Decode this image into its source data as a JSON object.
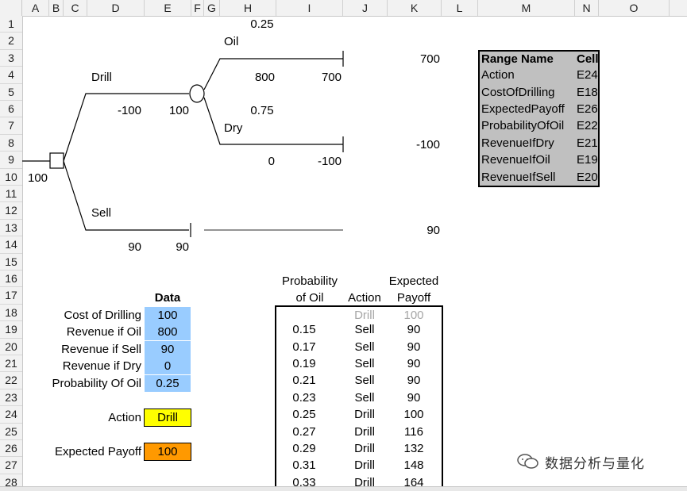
{
  "columns": [
    "A",
    "B",
    "C",
    "D",
    "E",
    "F",
    "G",
    "H",
    "I",
    "J",
    "K",
    "L",
    "M",
    "N",
    "O"
  ],
  "rows": [
    "1",
    "2",
    "3",
    "4",
    "5",
    "6",
    "7",
    "8",
    "9",
    "10",
    "11",
    "12",
    "13",
    "14",
    "15",
    "16",
    "17",
    "18",
    "19",
    "20",
    "21",
    "22",
    "23",
    "24",
    "25",
    "26",
    "27",
    "28"
  ],
  "tree": {
    "prob_oil": "0.25",
    "oil_label": "Oil",
    "oil_revenue": "800",
    "oil_total": "700",
    "oil_end": "700",
    "drill_label": "Drill",
    "drill_cost": "-100",
    "drill_value": "100",
    "prob_dry": "0.75",
    "dry_label": "Dry",
    "dry_end": "-100",
    "dry_revenue": "0",
    "dry_total": "-100",
    "root_value": "100",
    "sell_label": "Sell",
    "sell_revenue": "90",
    "sell_total": "90",
    "sell_end": "90"
  },
  "range_names": {
    "header_name": "Range Name",
    "header_cell": "Cell",
    "rows": [
      {
        "name": "Action",
        "cell": "E24"
      },
      {
        "name": "CostOfDrilling",
        "cell": "E18"
      },
      {
        "name": "ExpectedPayoff",
        "cell": "E26"
      },
      {
        "name": "ProbabilityOfOil",
        "cell": "E22"
      },
      {
        "name": "RevenueIfDry",
        "cell": "E21"
      },
      {
        "name": "RevenueIfOil",
        "cell": "E19"
      },
      {
        "name": "RevenueIfSell",
        "cell": "E20"
      }
    ]
  },
  "inputs": {
    "data_header": "Data",
    "cost_label": "Cost of Drilling",
    "cost_value": "100",
    "rev_oil_label": "Revenue if Oil",
    "rev_oil_value": "800",
    "rev_sell_label": "Revenue if Sell",
    "rev_sell_value": "90",
    "rev_dry_label": "Revenue if Dry",
    "rev_dry_value": "0",
    "prob_label": "Probability Of Oil",
    "prob_value": "0.25",
    "action_label": "Action",
    "action_value": "Drill",
    "payoff_label": "Expected Payoff",
    "payoff_value": "100",
    "colors": {
      "input_blue": "#99ccff",
      "action_yellow": "#ffff00",
      "payoff_orange": "#ff9900"
    }
  },
  "data_table": {
    "header_prob_1": "Probability",
    "header_prob_2": "of Oil",
    "header_action": "Action",
    "header_payoff_1": "Expected",
    "header_payoff_2": "Payoff",
    "first_row": {
      "prob": "",
      "action": "Drill",
      "payoff": "100"
    },
    "rows": [
      {
        "prob": "0.15",
        "action": "Sell",
        "payoff": "90"
      },
      {
        "prob": "0.17",
        "action": "Sell",
        "payoff": "90"
      },
      {
        "prob": "0.19",
        "action": "Sell",
        "payoff": "90"
      },
      {
        "prob": "0.21",
        "action": "Sell",
        "payoff": "90"
      },
      {
        "prob": "0.23",
        "action": "Sell",
        "payoff": "90"
      },
      {
        "prob": "0.25",
        "action": "Drill",
        "payoff": "100"
      },
      {
        "prob": "0.27",
        "action": "Drill",
        "payoff": "116"
      },
      {
        "prob": "0.29",
        "action": "Drill",
        "payoff": "132"
      },
      {
        "prob": "0.31",
        "action": "Drill",
        "payoff": "148"
      },
      {
        "prob": "0.33",
        "action": "Drill",
        "payoff": "164"
      }
    ]
  },
  "watermark": {
    "text": "数据分析与量化",
    "icon": "wechat-icon"
  }
}
